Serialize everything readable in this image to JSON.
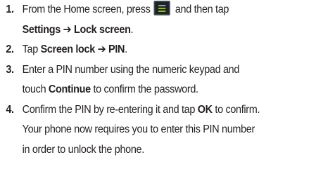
{
  "steps": [
    {
      "number": "1.",
      "line1_before": "From the Home screen, press",
      "line1_after": "and then tap",
      "icon": "menu-icon",
      "line2_bold": "Settings ➔ Lock screen",
      "line2_end": "."
    },
    {
      "number": "2.",
      "prefix": "Tap ",
      "bold": "Screen lock ➔ PIN",
      "suffix": "."
    },
    {
      "number": "3.",
      "line1": "Enter a PIN number using the numeric keypad and",
      "line2_prefix": "touch ",
      "line2_bold": "Continue",
      "line2_suffix": " to confirm the password."
    },
    {
      "number": "4.",
      "line1_prefix": "Confirm the PIN by re-entering it and tap ",
      "line1_bold": "OK",
      "line1_suffix": " to confirm.",
      "line2": "Your phone now requires you to enter this PIN number",
      "line3": "in order to unlock the phone."
    }
  ],
  "colors": {
    "text": "#231f20",
    "icon_bg": "#1f2326",
    "icon_bars": "#8fb82f"
  }
}
